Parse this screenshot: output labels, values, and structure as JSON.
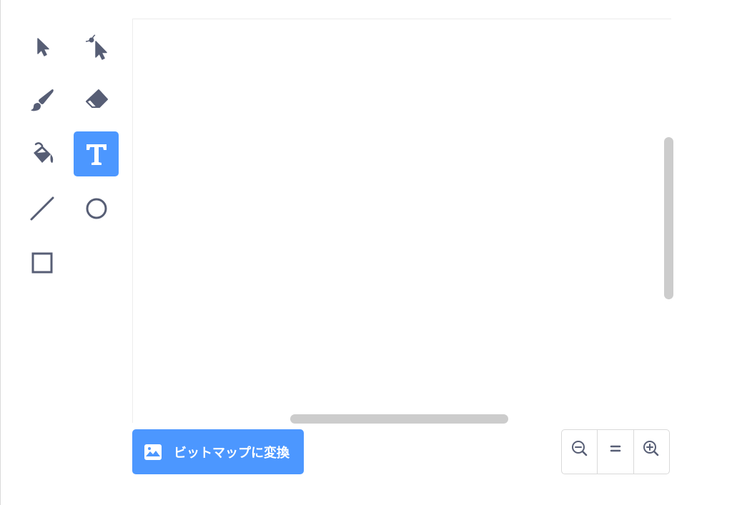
{
  "toolbar": {
    "tools": [
      {
        "name": "select",
        "icon": "arrow-pointer-icon",
        "active": false
      },
      {
        "name": "reshape",
        "icon": "reshape-pointer-icon",
        "active": false
      },
      {
        "name": "brush",
        "icon": "brush-icon",
        "active": false
      },
      {
        "name": "eraser",
        "icon": "eraser-icon",
        "active": false
      },
      {
        "name": "fill",
        "icon": "paint-bucket-icon",
        "active": false
      },
      {
        "name": "text",
        "icon": "text-t-icon",
        "active": true
      },
      {
        "name": "line",
        "icon": "line-icon",
        "active": false
      },
      {
        "name": "circle",
        "icon": "circle-icon",
        "active": false
      },
      {
        "name": "rectangle",
        "icon": "rectangle-icon",
        "active": false
      }
    ],
    "active_color": "#4c97ff",
    "icon_color": "#575e75"
  },
  "convert": {
    "label": "ビットマップに変換",
    "icon": "bitmap-image-icon"
  },
  "zoom": {
    "zoom_out_icon": "zoom-out-icon",
    "reset_label": "=",
    "zoom_in_icon": "zoom-in-icon"
  }
}
